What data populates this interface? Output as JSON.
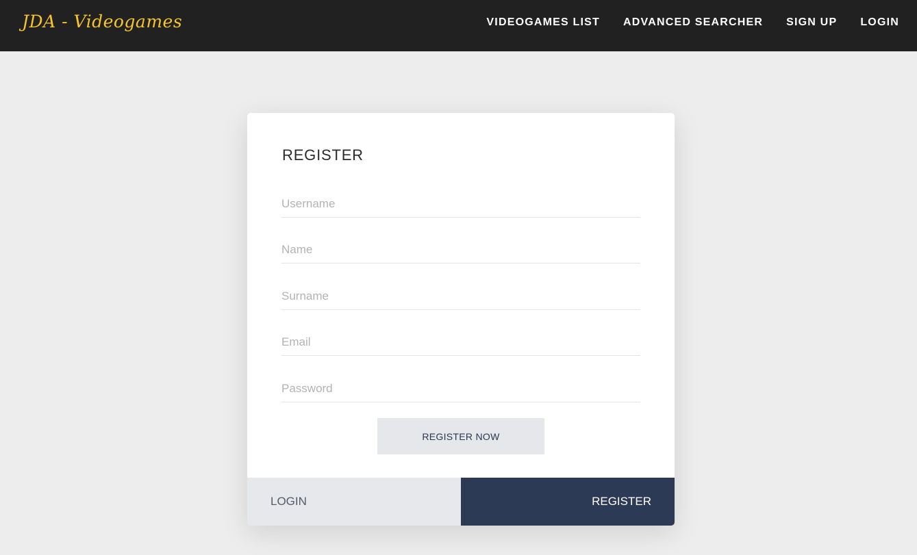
{
  "navbar": {
    "brand": "JDA - Videogames",
    "links": [
      {
        "label": "VIDEOGAMES LIST"
      },
      {
        "label": "ADVANCED SEARCHER"
      },
      {
        "label": "SIGN UP"
      },
      {
        "label": "LOGIN"
      }
    ]
  },
  "form": {
    "title": "REGISTER",
    "fields": {
      "username": {
        "placeholder": "Username",
        "value": ""
      },
      "name": {
        "placeholder": "Name",
        "value": ""
      },
      "surname": {
        "placeholder": "Surname",
        "value": ""
      },
      "email": {
        "placeholder": "Email",
        "value": ""
      },
      "password": {
        "placeholder": "Password",
        "value": ""
      }
    },
    "submit_label": "REGISTER NOW"
  },
  "tabs": {
    "login_label": "LOGIN",
    "register_label": "REGISTER"
  },
  "colors": {
    "navbar_bg": "#212121",
    "brand": "#f7c52a",
    "page_bg": "#ededed",
    "active_tab": "#2d3a55",
    "inactive_tab": "#e7e8eb"
  }
}
